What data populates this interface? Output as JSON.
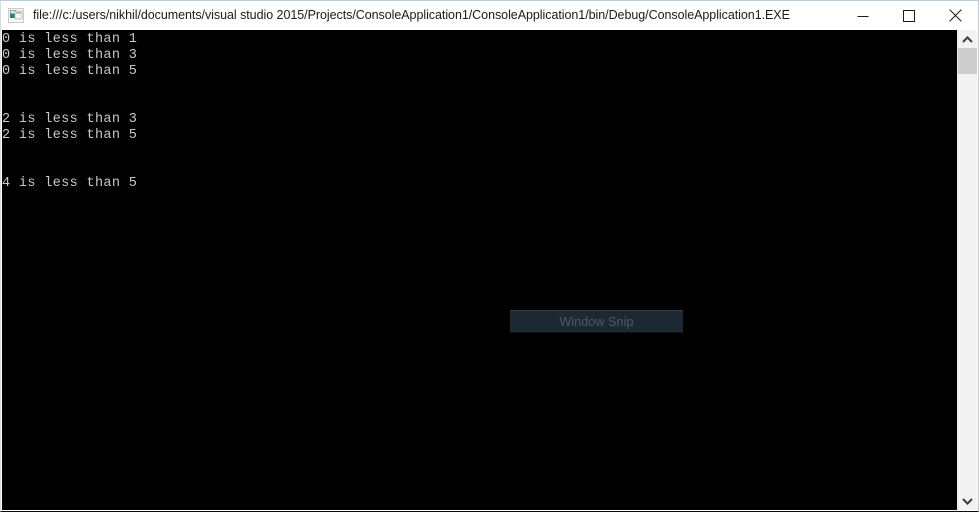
{
  "window": {
    "title": "file:///c:/users/nikhil/documents/visual studio 2015/Projects/ConsoleApplication1/ConsoleApplication1/bin/Debug/ConsoleApplication1.EXE",
    "icon": "console-window-icon",
    "controls": {
      "minimize": {
        "icon": "minimize-icon",
        "label": "Minimize"
      },
      "maximize": {
        "icon": "maximize-icon",
        "label": "Maximize"
      },
      "close": {
        "icon": "close-icon",
        "label": "Close"
      }
    },
    "colors": {
      "titlebar_background": "#ffffff",
      "titlebar_text": "#1b1b1b",
      "console_background": "#000000",
      "console_text": "#c8c8c8",
      "frame_border": "#b8ccd9",
      "scrollbar_track": "#f2f2f2",
      "scrollbar_thumb": "#cdcdcd"
    }
  },
  "console": {
    "lines": [
      "0 is less than 1",
      "0 is less than 3",
      "0 is less than 5",
      "",
      "",
      "2 is less than 3",
      "2 is less than 5",
      "",
      "",
      "4 is less than 5"
    ],
    "text": "0 is less than 1\n0 is less than 3\n0 is less than 5\n\n\n2 is less than 3\n2 is less than 5\n\n\n4 is less than 5"
  },
  "overlay": {
    "label": "Window Snip",
    "name": "window-snip-overlay"
  },
  "scrollbar": {
    "up_arrow_icon": "chevron-up-icon",
    "down_arrow_icon": "chevron-down-icon"
  }
}
